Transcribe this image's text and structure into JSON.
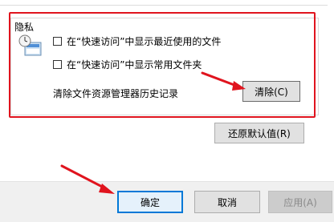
{
  "group": {
    "title": "隐私"
  },
  "options": [
    {
      "label": "在“快速访问”中显示最近使用的文件",
      "checked": false
    },
    {
      "label": "在“快速访问”中显示常用文件夹",
      "checked": false
    }
  ],
  "clear_history": {
    "label": "清除文件资源管理器历史记录",
    "button": "清除(C)"
  },
  "restore_button": "还原默认值(R)",
  "footer": {
    "ok": "确定",
    "cancel": "取消",
    "apply": "应用(A)"
  },
  "colors": {
    "highlight": "#e0141e",
    "accent": "#0078d7"
  },
  "icons": {
    "privacy": "privacy-icon"
  }
}
